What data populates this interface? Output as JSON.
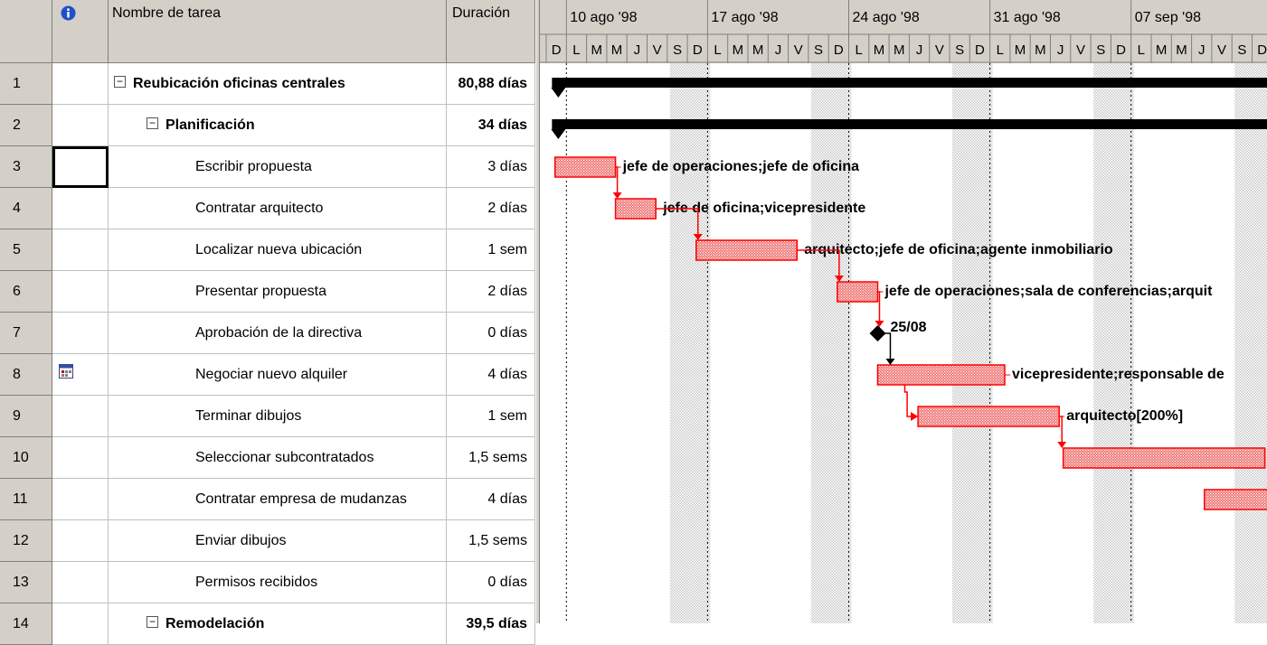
{
  "table": {
    "headers": {
      "indicators_icon": "info-icon",
      "name": "Nombre de tarea",
      "duration": "Duración"
    },
    "rows": [
      {
        "id": "1",
        "name": "Reubicación oficinas centrales",
        "duration": "80,88 días",
        "level": 0,
        "summary": true
      },
      {
        "id": "2",
        "name": "Planificación",
        "duration": "34 días",
        "level": 1,
        "summary": true
      },
      {
        "id": "3",
        "name": "Escribir propuesta",
        "duration": "3 días",
        "level": 2,
        "summary": false
      },
      {
        "id": "4",
        "name": "Contratar arquitecto",
        "duration": "2 días",
        "level": 2,
        "summary": false
      },
      {
        "id": "5",
        "name": "Localizar nueva ubicación",
        "duration": "1 sem",
        "level": 2,
        "summary": false
      },
      {
        "id": "6",
        "name": "Presentar propuesta",
        "duration": "2 días",
        "level": 2,
        "summary": false
      },
      {
        "id": "7",
        "name": "Aprobación de la directiva",
        "duration": "0 días",
        "level": 2,
        "summary": false
      },
      {
        "id": "8",
        "name": "Negociar nuevo alquiler",
        "duration": "4 días",
        "level": 2,
        "summary": false,
        "indicator": "calendar-icon"
      },
      {
        "id": "9",
        "name": "Terminar dibujos",
        "duration": "1 sem",
        "level": 2,
        "summary": false
      },
      {
        "id": "10",
        "name": "Seleccionar subcontratados",
        "duration": "1,5 sems",
        "level": 2,
        "summary": false
      },
      {
        "id": "11",
        "name": "Contratar empresa de mudanzas",
        "duration": "4 días",
        "level": 2,
        "summary": false
      },
      {
        "id": "12",
        "name": "Enviar dibujos",
        "duration": "1,5 sems",
        "level": 2,
        "summary": false
      },
      {
        "id": "13",
        "name": "Permisos recibidos",
        "duration": "0 días",
        "level": 2,
        "summary": false
      },
      {
        "id": "14",
        "name": "Remodelación",
        "duration": "39,5 días",
        "level": 1,
        "summary": true
      }
    ]
  },
  "gantt": {
    "weeks": [
      "10 ago '98",
      "17 ago '98",
      "24 ago '98",
      "31 ago '98",
      "07 sep '98"
    ],
    "day_letters": [
      "D",
      "L",
      "M",
      "M",
      "J",
      "V",
      "S"
    ],
    "bars": [
      {
        "row": 3,
        "start": 0.3,
        "days": 3,
        "label": "jefe de operaciones;jefe de oficina"
      },
      {
        "row": 4,
        "start": 3.3,
        "days": 2,
        "label": "jefe de oficina;vicepresidente"
      },
      {
        "row": 5,
        "start": 7.3,
        "days": 5,
        "label": "arquitecto;jefe de oficina;agente inmobiliario"
      },
      {
        "row": 6,
        "start": 14.3,
        "days": 2,
        "label": "jefe de operaciones;sala de conferencias;arquit"
      },
      {
        "row": 8,
        "start": 16.3,
        "days": 6.3,
        "label": "vicepresidente;responsable  de"
      },
      {
        "row": 9,
        "start": 18.3,
        "days": 7,
        "label": "arquitecto[200%]"
      },
      {
        "row": 10,
        "start": 25.5,
        "days": 10,
        "label": ""
      },
      {
        "row": 11,
        "start": 32.5,
        "days": 4,
        "label": ""
      }
    ],
    "milestone": {
      "row": 7,
      "day": 16.3,
      "label": "25/08"
    },
    "colors": {
      "task_bar": "#ff0000",
      "task_fill": "#f08080",
      "summary_bar": "#000000",
      "link": "#ff0000",
      "weekend": "#c8c8c8"
    }
  }
}
